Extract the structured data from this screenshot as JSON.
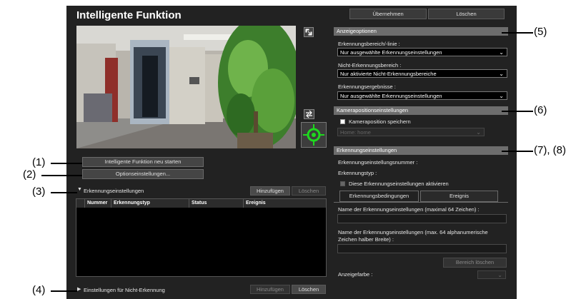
{
  "app": {
    "title": "Intelligente Funktion",
    "apply_label": "Übernehmen",
    "delete_label": "Löschen"
  },
  "left": {
    "restart_button": "Intelligente Funktion neu starten",
    "options_button": "Optionseinstellungen...",
    "detection_panel": {
      "title": "Erkennungseinstellungen",
      "add_label": "Hinzufügen",
      "delete_label": "Löschen",
      "columns": [
        "Nummer",
        "Erkennungstyp",
        "Status",
        "Ereignis"
      ]
    },
    "nondetect_panel": {
      "title": "Einstellungen für Nicht-Erkennung",
      "add_label": "Hinzufügen",
      "delete_label": "Löschen"
    }
  },
  "right": {
    "display_options": {
      "header": "Anzeigeoptionen",
      "area_label": "Erkennungsbereich/-linie :",
      "area_value": "Nur ausgewählte Erkennungseinstellungen",
      "nondetect_label": "Nicht-Erkennungsbereich :",
      "nondetect_value": "Nur aktivierte Nicht-Erkennungsbereiche",
      "results_label": "Erkennungsergebnisse :",
      "results_value": "Nur ausgewählte Erkennungseinstellungen"
    },
    "camera_position": {
      "header": "Kamerapositionseinstellungen",
      "save_label": "Kameraposition speichern",
      "preset_value": "Home: home"
    },
    "detection_settings": {
      "header": "Erkennungseinstellungen",
      "number_label": "Erkennungseinstellungsnummer :",
      "type_label": "Erkennungstyp :",
      "activate_label": "Diese Erkennungseinstellungen aktivieren",
      "tab_conditions": "Erkennungsbedingungen",
      "tab_event": "Ereignis",
      "name_label": "Name der Erkennungseinstellungen (maximal 64 Zeichen) :",
      "name_alnum_label_line1": "Name der Erkennungseinstellungen (max. 64 alphanumerische",
      "name_alnum_label_line2": "Zeichen halber Breite) :",
      "clear_area_button": "Bereich löschen",
      "display_color_label": "Anzeigefarbe :"
    }
  },
  "callouts": {
    "c1": "(1)",
    "c2": "(2)",
    "c3": "(3)",
    "c4": "(4)",
    "c5": "(5)",
    "c6": "(6)",
    "c78": "(7), (8)"
  },
  "icons": {
    "fullscreen": "fullscreen-icon",
    "swap": "swap-arrows-icon",
    "target": "camera-target-icon",
    "triangle_down": "triangle-down-icon",
    "triangle_right": "triangle-right-icon"
  },
  "colors": {
    "app_background": "#222222",
    "section_header": "#6d6d6d",
    "target_icon": "#1fd81f"
  }
}
